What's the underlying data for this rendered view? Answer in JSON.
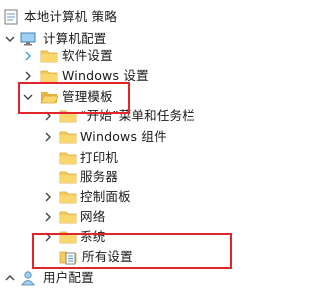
{
  "colors": {
    "folder_fill": "#f6cd5a",
    "folder_tab": "#e9b43c",
    "highlight_red": "#e0262b",
    "chevron": "#444444",
    "blue_chevron": "#3aa0ff"
  },
  "tree": {
    "root": {
      "label": "本地计算机 策略",
      "icon": "policy-icon"
    },
    "computer_config": {
      "label": "计算机配置",
      "icon": "computer-icon"
    },
    "software_settings": {
      "label": "软件设置",
      "icon": "folder-icon"
    },
    "windows_settings": {
      "label": "Windows 设置",
      "icon": "folder-icon"
    },
    "admin_templates": {
      "label": "管理模板",
      "icon": "folder-icon"
    },
    "start_menu": {
      "label": "“开始”菜单和任务栏",
      "icon": "folder-icon"
    },
    "windows_components": {
      "label": "Windows 组件",
      "icon": "folder-icon"
    },
    "printers": {
      "label": "打印机",
      "icon": "folder-icon"
    },
    "servers": {
      "label": "服务器",
      "icon": "folder-icon"
    },
    "control_panel": {
      "label": "控制面板",
      "icon": "folder-icon"
    },
    "network": {
      "label": "网络",
      "icon": "folder-icon"
    },
    "system": {
      "label": "系统",
      "icon": "folder-icon"
    },
    "all_settings": {
      "label": "所有设置",
      "icon": "settings-page-icon"
    },
    "user_config": {
      "label": "用户配置",
      "icon": "user-icon"
    }
  }
}
